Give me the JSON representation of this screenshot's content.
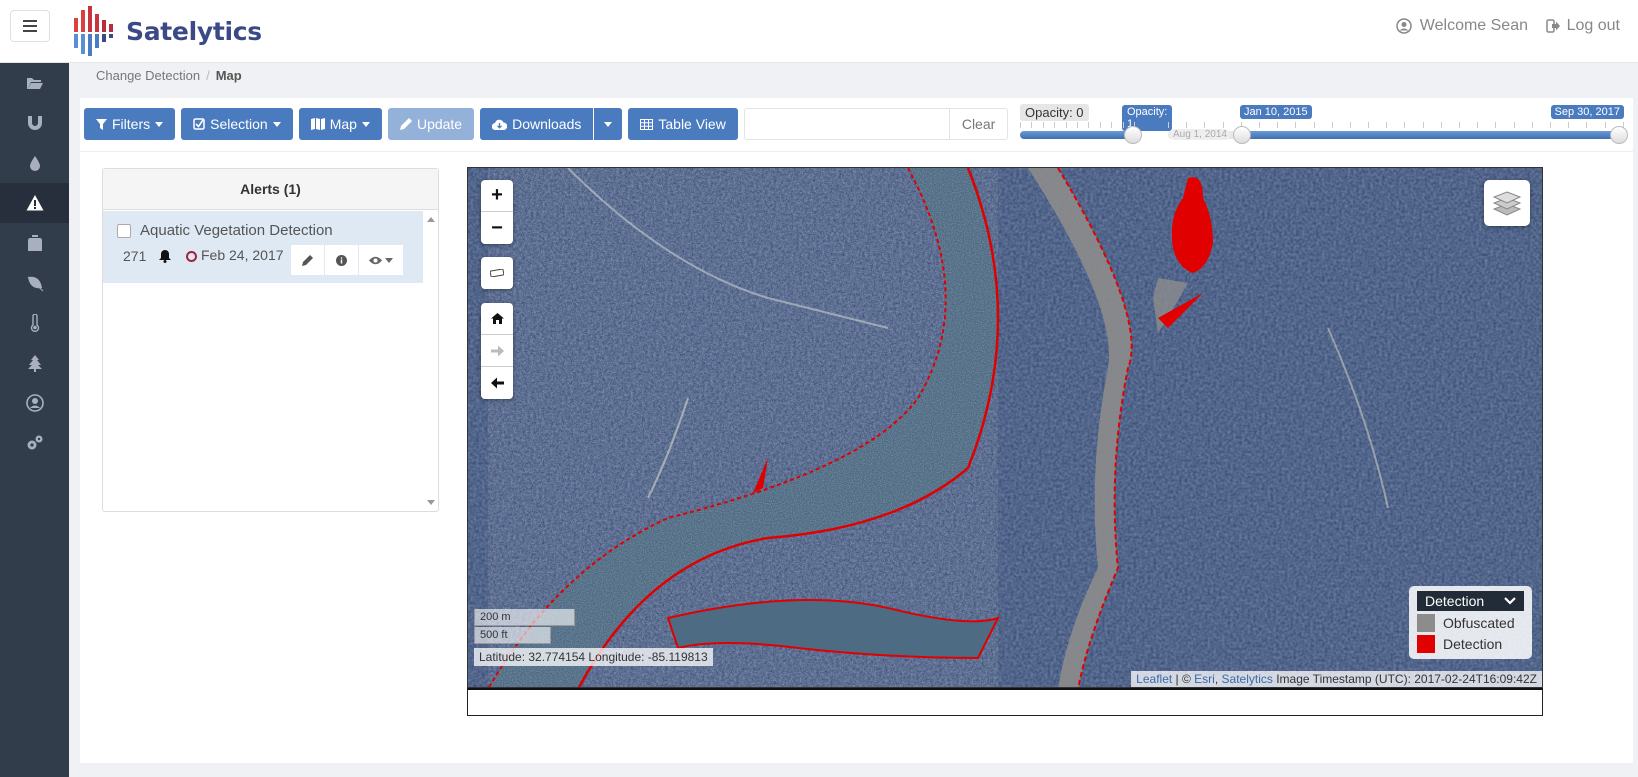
{
  "app": {
    "brand": "Satelytics",
    "user_greeting": "Welcome Sean",
    "logout_label": "Log out"
  },
  "sidebar": {
    "items": [
      {
        "icon": "folder-open-icon",
        "label": "Projects"
      },
      {
        "icon": "magnet-icon",
        "label": "Magnet"
      },
      {
        "icon": "droplet-icon",
        "label": "Water"
      },
      {
        "icon": "warning-icon",
        "label": "Alerts",
        "active": true
      },
      {
        "icon": "backpack-icon",
        "label": "Field"
      },
      {
        "icon": "leaf-icon",
        "label": "Vegetation"
      },
      {
        "icon": "thermometer-icon",
        "label": "Temperature"
      },
      {
        "icon": "tree-icon",
        "label": "Forestry"
      },
      {
        "icon": "user-circle-icon",
        "label": "Account"
      },
      {
        "icon": "gears-icon",
        "label": "Settings"
      }
    ]
  },
  "breadcrumb": {
    "parent": "Change Detection",
    "separator": "/",
    "current": "Map"
  },
  "toolbar": {
    "filters_label": "Filters",
    "selection_label": "Selection",
    "map_label": "Map",
    "update_label": "Update",
    "downloads_label": "Downloads",
    "table_view_label": "Table View",
    "search_value": "",
    "search_placeholder": "",
    "clear_label": "Clear"
  },
  "opacity_slider": {
    "min_label": "Opacity: 0",
    "value_label": "Opacity: 1",
    "value": 1
  },
  "date_slider": {
    "min_label": "Aug 1, 2014",
    "start_label": "Jan 10, 2015",
    "end_label": "Sep 30, 2017"
  },
  "alerts": {
    "header": "Alerts (1)",
    "items": [
      {
        "title": "Aquatic Vegetation Detection",
        "count": "271",
        "date": "Feb 24, 2017",
        "checked": false
      }
    ]
  },
  "map": {
    "scale_metric": "200 m",
    "scale_imperial": "500 ft",
    "coordinates": "Latitude: 32.774154 Longitude: -85.119813",
    "legend": {
      "title": "Detection",
      "items": [
        {
          "label": "Obfuscated",
          "color": "#8c8c8c"
        },
        {
          "label": "Detection",
          "color": "#e00000"
        }
      ]
    },
    "attribution": {
      "leaflet": "Leaflet",
      "sep1": " | © ",
      "esri": "Esri",
      "sep2": ", ",
      "satelytics": "Satelytics",
      "timestamp": " Image Timestamp (UTC): 2017-02-24T16:09:42Z"
    }
  },
  "colors": {
    "primary": "#4a7bbf",
    "sidebar_bg": "#323d4c",
    "brand_text": "#3b4a86",
    "detection": "#e00000",
    "obfuscated": "#8c8c8c"
  }
}
